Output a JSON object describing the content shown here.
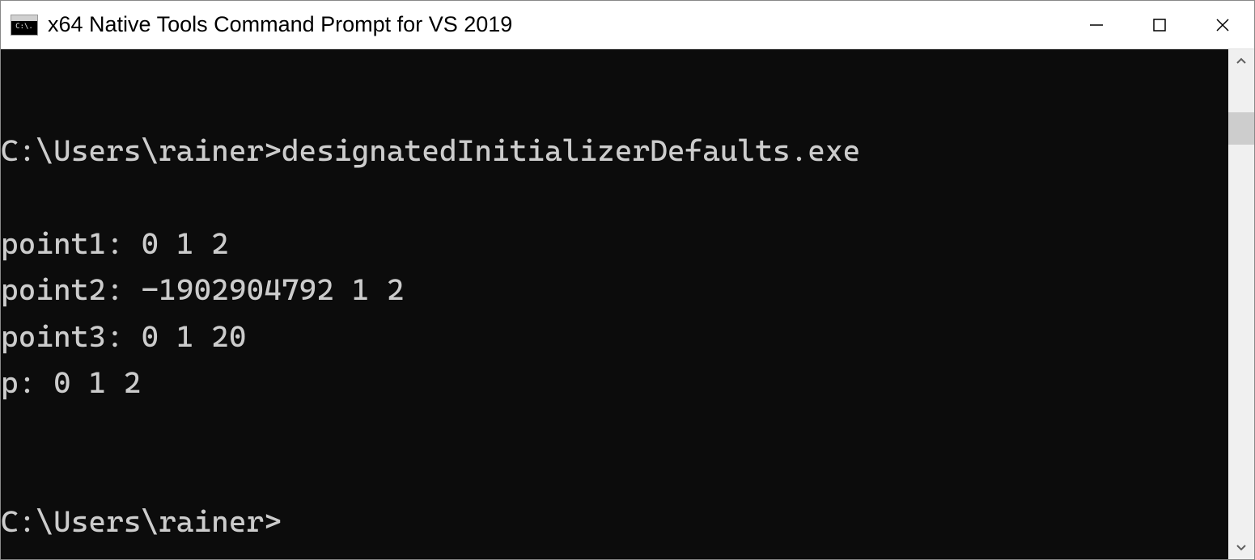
{
  "window": {
    "title": "x64 Native Tools Command Prompt for VS 2019",
    "icon_text": "C:\\."
  },
  "terminal": {
    "lines": [
      "",
      "C:\\Users\\rainer>designatedInitializerDefaults.exe",
      "",
      "point1: 0 1 2",
      "point2: -1902904792 1 2",
      "point3: 0 1 20",
      "p: 0 1 2",
      "",
      "",
      "C:\\Users\\rainer>"
    ]
  }
}
